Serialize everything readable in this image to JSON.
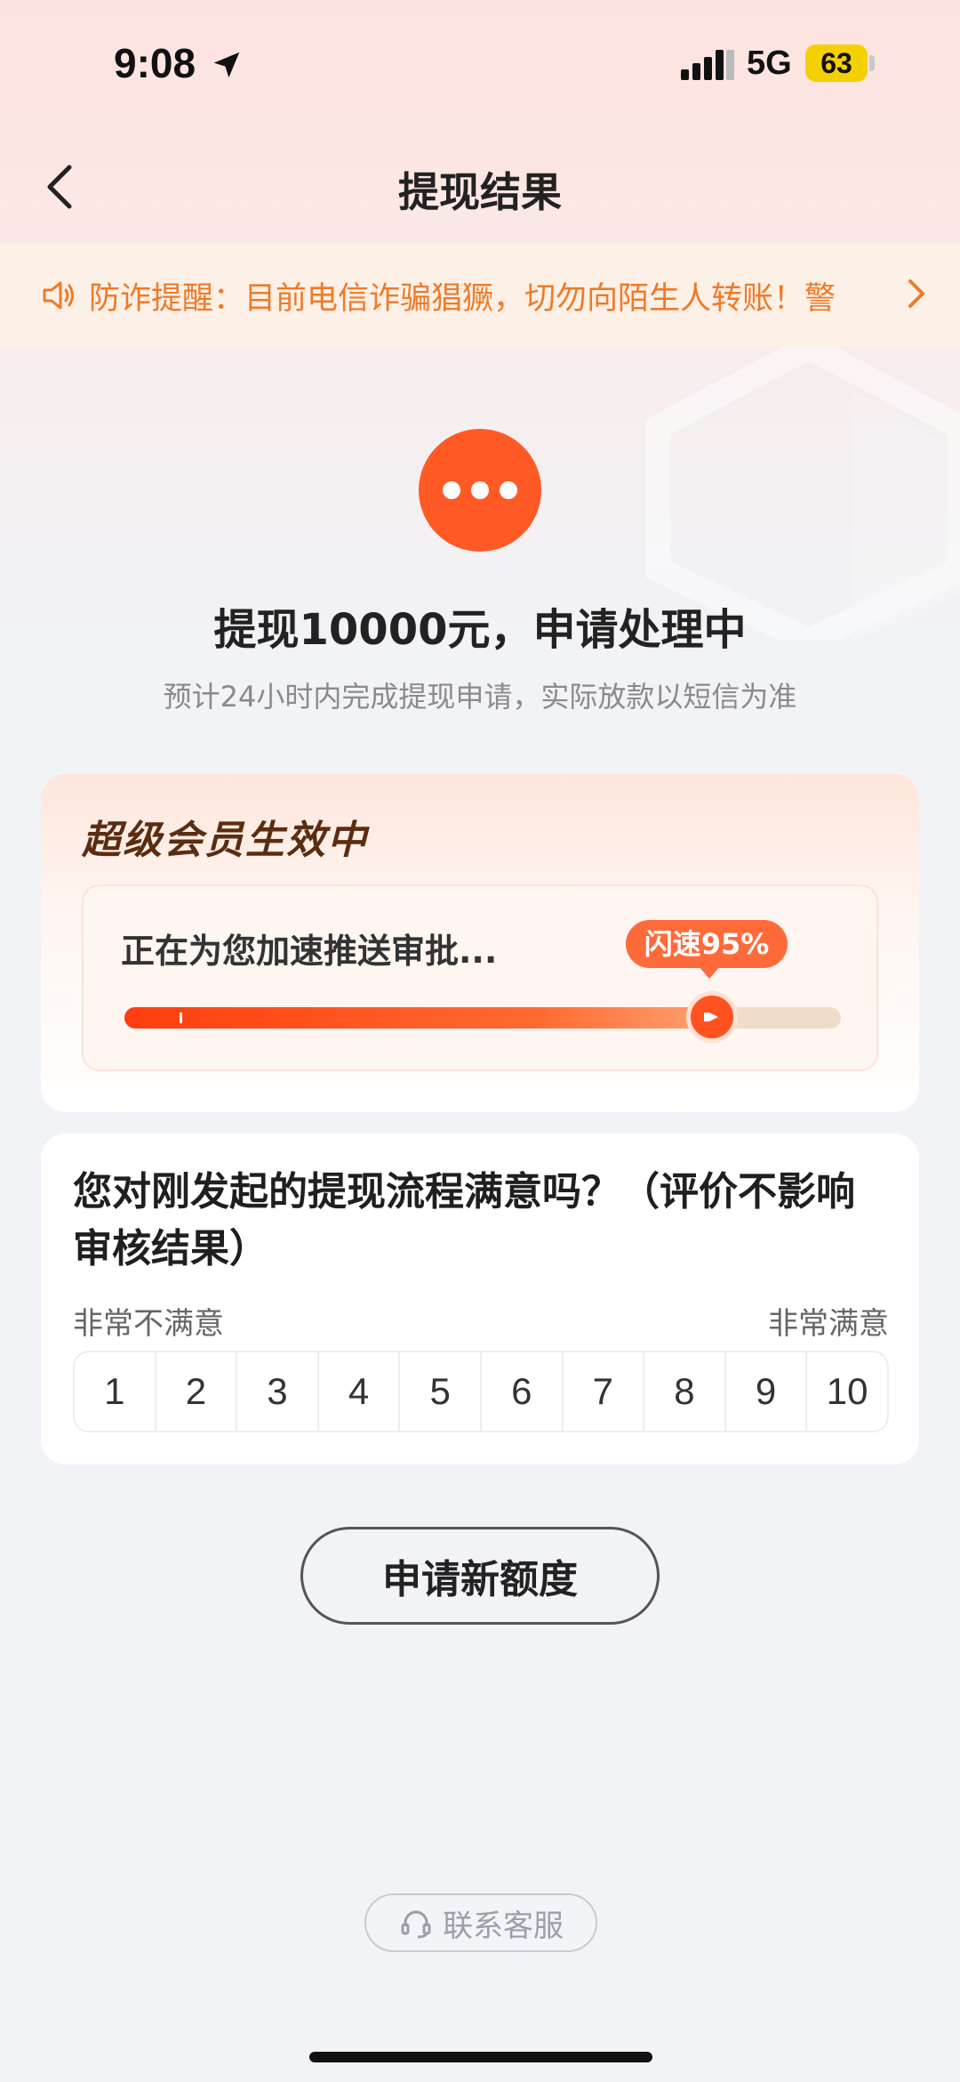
{
  "status_bar": {
    "time": "9:08",
    "network": "5G",
    "battery": "63"
  },
  "nav": {
    "title": "提现结果"
  },
  "notice": {
    "text": "防诈提醒：目前电信诈骗猖獗，切勿向陌生人转账！警"
  },
  "result": {
    "title": "提现10000元，申请处理中",
    "subtitle": "预计24小时内完成提现申请，实际放款以短信为准"
  },
  "member": {
    "title": "超级会员生效中",
    "progress_text": "正在为您加速推送审批...",
    "badge": "闪速95%",
    "progress_percent": 82
  },
  "rating": {
    "question": "您对刚发起的提现流程满意吗？（评价不影响审核结果）",
    "low_label": "非常不满意",
    "high_label": "非常满意",
    "scale": [
      "1",
      "2",
      "3",
      "4",
      "5",
      "6",
      "7",
      "8",
      "9",
      "10"
    ]
  },
  "actions": {
    "apply_label": "申请新额度",
    "contact_label": "联系客服"
  },
  "colors": {
    "accent": "#ff5a26",
    "notice": "#ef7a28"
  }
}
